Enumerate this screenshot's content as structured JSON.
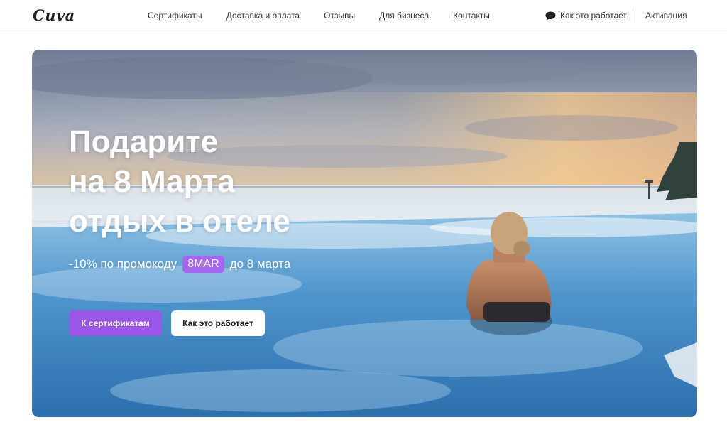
{
  "header": {
    "logo": "Cuva",
    "nav": [
      "Сертификаты",
      "Доставка и оплата",
      "Отзывы",
      "Для бизнеса",
      "Контакты"
    ],
    "how_it_works": "Как это работает",
    "activation": "Активация"
  },
  "hero": {
    "title_lines": [
      "Подарите",
      "на 8 Марта",
      "отдых в отеле"
    ],
    "promo_prefix": "-10% по промокоду",
    "promo_code": "8MAR",
    "promo_suffix": "до 8 марта",
    "primary_button": "К сертификатам",
    "secondary_button": "Как это работает"
  },
  "colors": {
    "accent": "#9b55e8",
    "promo_badge": "#a665f2"
  },
  "icons": {
    "chat": "chat-bubble-icon"
  }
}
